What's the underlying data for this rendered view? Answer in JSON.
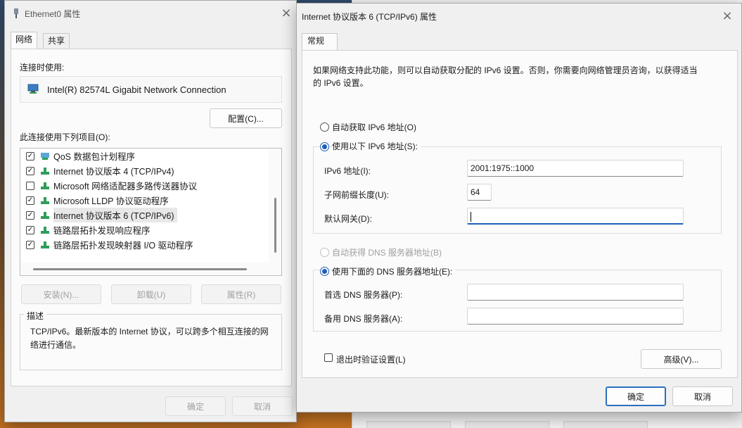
{
  "eth_window": {
    "title": "Ethernet0 属性",
    "tabs": [
      {
        "label": "网络",
        "active": true
      },
      {
        "label": "共享",
        "active": false
      }
    ],
    "connect_using_label": "连接时使用:",
    "adapter_name": "Intel(R) 82574L Gigabit Network Connection",
    "configure_button": "配置(C)...",
    "items_label": "此连接使用下列项目(O):",
    "items": [
      {
        "label": "QoS 数据包计划程序",
        "checked": true
      },
      {
        "label": "Internet 协议版本 4 (TCP/IPv4)",
        "checked": true
      },
      {
        "label": "Microsoft 网络适配器多路传送器协议",
        "checked": false
      },
      {
        "label": "Microsoft LLDP 协议驱动程序",
        "checked": true
      },
      {
        "label": "Internet 协议版本 6 (TCP/IPv6)",
        "checked": true,
        "selected": true
      },
      {
        "label": "链路层拓扑发现响应程序",
        "checked": true
      },
      {
        "label": "链路层拓扑发现映射器 I/O 驱动程序",
        "checked": true
      }
    ],
    "install_button": "安装(N)...",
    "uninstall_button": "卸载(U)",
    "properties_button": "属性(R)",
    "description_title": "描述",
    "description_text": "TCP/IPv6。最新版本的 Internet 协议，可以跨多个相互连接的网络进行通信。",
    "ok_button": "确定",
    "cancel_button": "取消"
  },
  "ipv6_window": {
    "title": "Internet 协议版本 6 (TCP/IPv6) 属性",
    "tab": "常规",
    "intro_line1": "如果网络支持此功能，则可以自动获取分配的 IPv6 设置。否则，你需要向网络管理员咨询，以获得适当",
    "intro_line2": "的 IPv6 设置。",
    "auto_ip_label": "自动获取 IPv6 地址(O)",
    "manual_ip_label": "使用以下 IPv6 地址(S):",
    "ipv6_address_label": "IPv6 地址(I):",
    "ipv6_address_value": "2001:1975::1000",
    "prefix_label": "子网前缀长度(U):",
    "prefix_value": "64",
    "gateway_label": "默认网关(D):",
    "gateway_value": "",
    "auto_dns_label": "自动获得 DNS 服务器地址(B)",
    "manual_dns_label": "使用下面的 DNS 服务器地址(E):",
    "preferred_dns_label": "首选 DNS 服务器(P):",
    "preferred_dns_value": "",
    "alternate_dns_label": "备用 DNS 服务器(A):",
    "alternate_dns_value": "",
    "validate_label": "退出时验证设置(L)",
    "advanced_button": "高级(V)...",
    "ok_button": "确定",
    "cancel_button": "取消"
  },
  "colors": {
    "accent": "#1e5fb8",
    "net_icon": "#2e9d5a"
  }
}
